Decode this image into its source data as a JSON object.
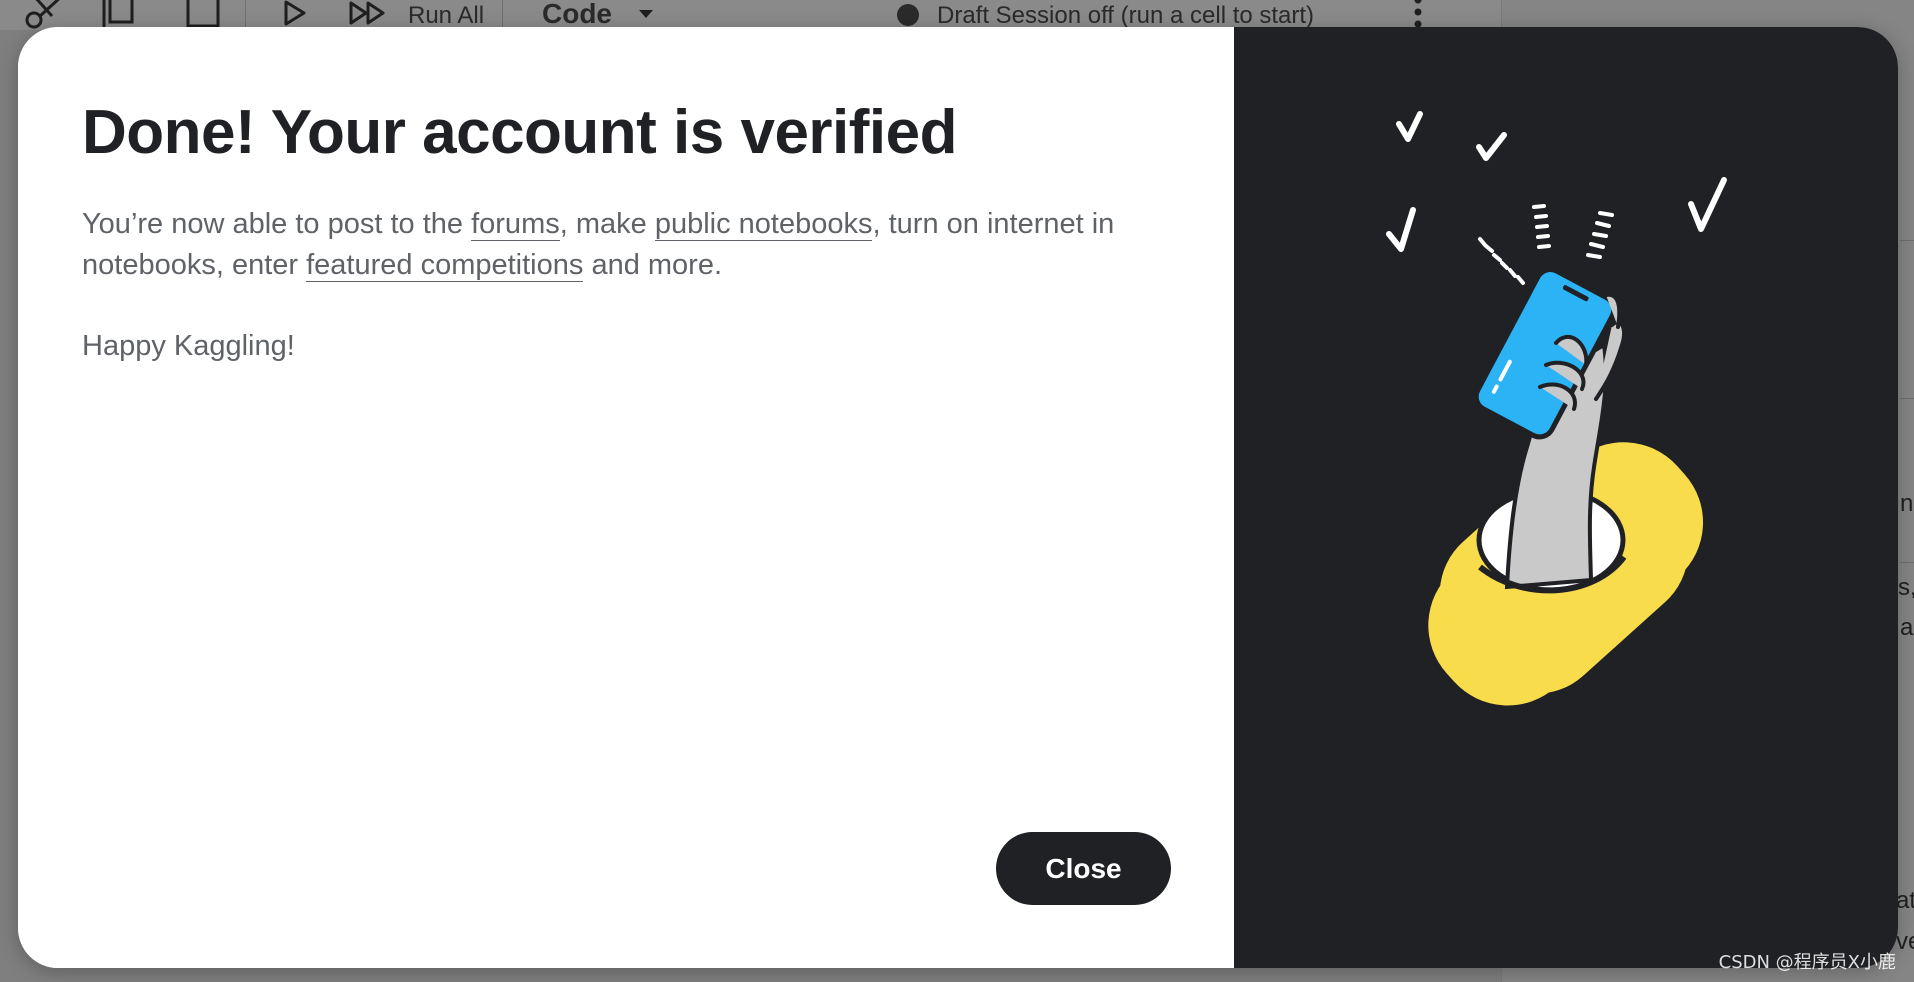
{
  "toolbar": {
    "run_all_label": "Run All",
    "cell_type_label": "Code",
    "session_status": "Draft Session off (run a cell to start)",
    "icons": [
      "scissors-icon",
      "copy-icon",
      "paste-icon",
      "play-icon",
      "fast-forward-icon",
      "caret-down-icon",
      "more-vert-icon",
      "status-dot-icon"
    ]
  },
  "background_fragments": [
    "n",
    "s,",
    "a",
    "at",
    "ve"
  ],
  "dialog": {
    "title": "Done! Your account is verified",
    "text_before_forums": "You’re now able to post to the ",
    "link_forums": "forums",
    "text_after_forums": ", make ",
    "link_public_notebooks": "public notebooks",
    "text_after_notebooks": ", turn on internet in notebooks, enter ",
    "link_featured_competitions": "featured competitions",
    "text_end": " and more.",
    "closing_line": "Happy Kaggling!",
    "close_label": "Close"
  },
  "colors": {
    "dialog_dark": "#202124",
    "phone_blue": "#2bb3f5",
    "hole_yellow": "#f9dc4c",
    "text_gray": "#5f6368"
  },
  "watermark": "CSDN @程序员X小鹿"
}
